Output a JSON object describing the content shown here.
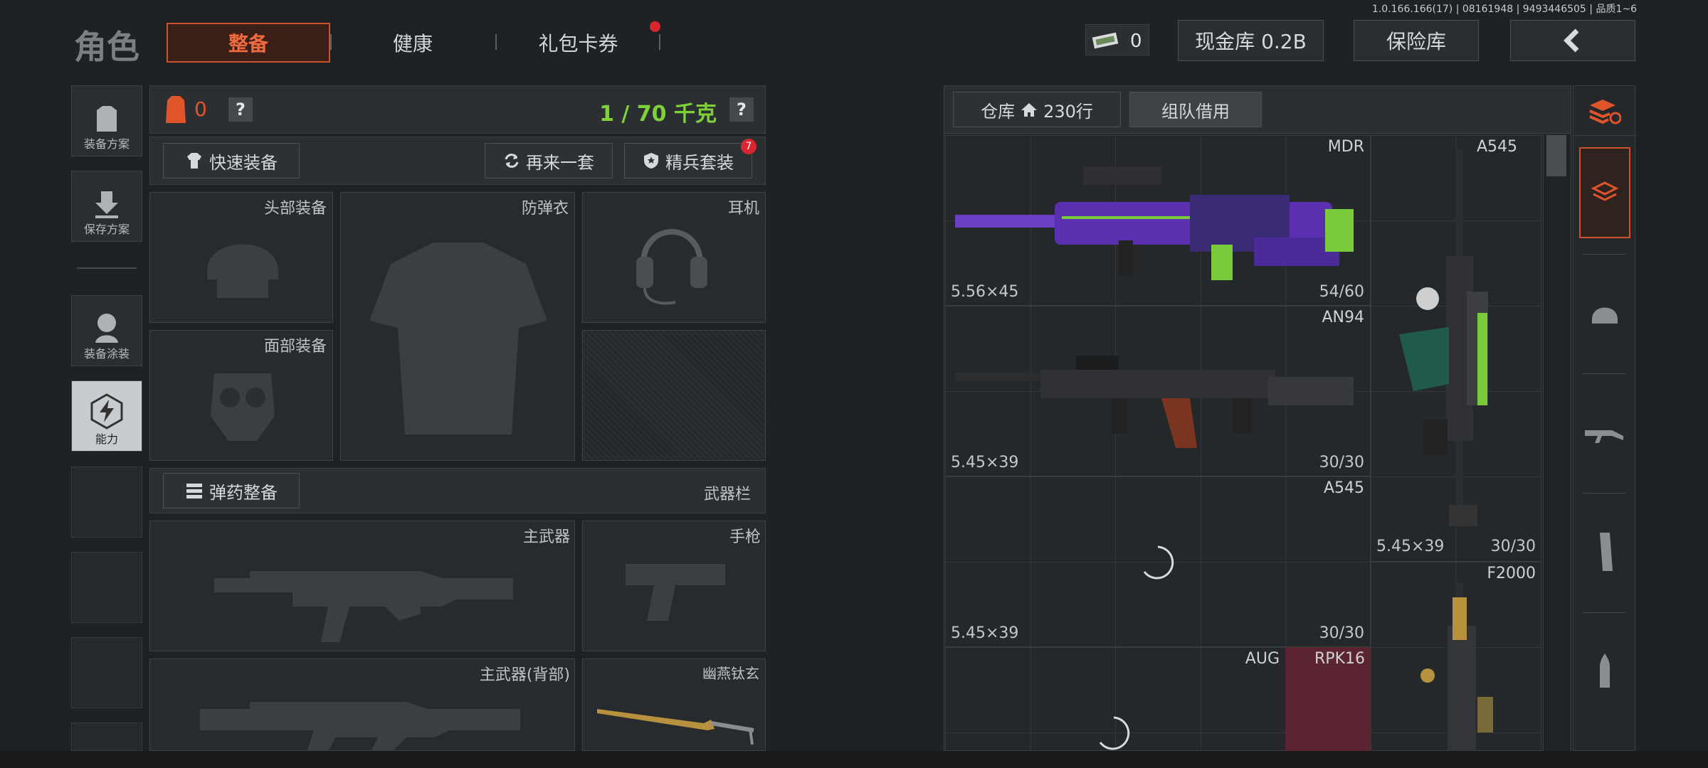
{
  "version_info": "1.0.166.166(17) | 08161948 | 9493446505 | 品质1~6",
  "header": {
    "title": "角色",
    "tabs": [
      {
        "label": "整备",
        "active": true
      },
      {
        "label": "健康"
      },
      {
        "label": "礼包卡券",
        "dot": true
      }
    ],
    "money_count": "0",
    "cash_vault": "现金库 0.2B",
    "insurance": "保险库"
  },
  "left_sidebar": {
    "items": [
      {
        "label": "装备方案"
      },
      {
        "label": "保存方案"
      },
      {
        "label": "装备涂装"
      },
      {
        "label": "能力",
        "active": true
      }
    ]
  },
  "loadout": {
    "bag_count": "0",
    "weight": "1 / 70 千克",
    "help": "?",
    "quick_equip": "快速装备",
    "again": "再来一套",
    "elite_set": "精兵套装",
    "elite_badge": "7",
    "slots": {
      "head": "头部装备",
      "vest": "防弹衣",
      "headset": "耳机",
      "face": "面部装备"
    },
    "ammo_equip": "弹药整备",
    "weapon_bar": "武器栏",
    "primary": "主武器",
    "pistol": "手枪",
    "primary_back": "主武器(背部)",
    "melee": "幽燕钛玄"
  },
  "warehouse": {
    "tab_label": "仓库",
    "rows": "230行",
    "team_borrow": "组队借用",
    "items": [
      {
        "name": "MDR",
        "caliber": "5.56×45",
        "ammo": "54/60"
      },
      {
        "name": "AN94",
        "caliber": "5.45×39",
        "ammo": "30/30"
      },
      {
        "name": "A545",
        "caliber": "5.45×39",
        "ammo": "30/30"
      },
      {
        "name": "A545",
        "caliber": "5.45×39",
        "ammo": "30/30"
      },
      {
        "name": "F2000"
      },
      {
        "name": "AUG"
      },
      {
        "name": "RPK16"
      }
    ]
  },
  "colors": {
    "accent": "#e0542a",
    "weight_green": "#7fd13a",
    "badge_red": "#d9262f",
    "rpk_highlight": "#5a2530"
  }
}
